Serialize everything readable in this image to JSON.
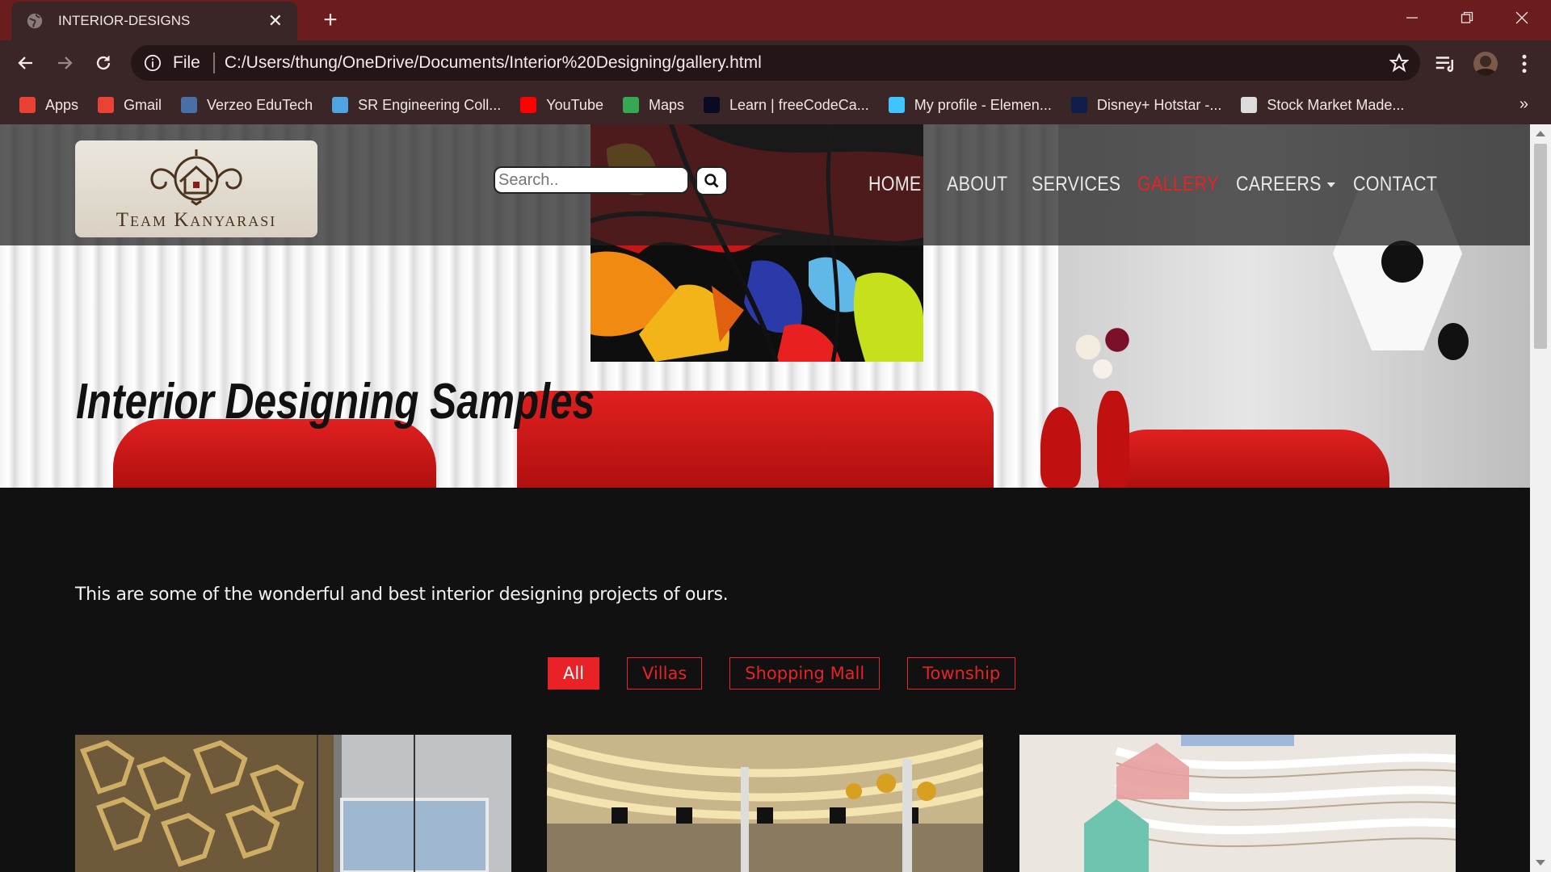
{
  "browser": {
    "tab_title": "INTERIOR-DESIGNS",
    "new_tab": "+",
    "address_scheme": "File",
    "address_url": "C:/Users/thung/OneDrive/Documents/Interior%20Designing/gallery.html",
    "bookmarks": [
      {
        "label": "Apps",
        "icon": "apps-grid-icon",
        "color": "#e94235"
      },
      {
        "label": "Gmail",
        "icon": "gmail-icon",
        "color": "#ea4335"
      },
      {
        "label": "Verzeo EduTech",
        "icon": "verzeo-icon",
        "color": "#4a6fa5"
      },
      {
        "label": "SR Engineering Coll...",
        "icon": "sr-engineering-icon",
        "color": "#4fa3e0"
      },
      {
        "label": "YouTube",
        "icon": "youtube-icon",
        "color": "#ff0000"
      },
      {
        "label": "Maps",
        "icon": "maps-icon",
        "color": "#34a853"
      },
      {
        "label": "Learn | freeCodeCa...",
        "icon": "freecodecamp-icon",
        "color": "#0a0a23"
      },
      {
        "label": "My profile - Elemen...",
        "icon": "element-icon",
        "color": "#40c4ff"
      },
      {
        "label": "Disney+ Hotstar -...",
        "icon": "hotstar-icon",
        "color": "#0f1d4a"
      },
      {
        "label": "Stock Market Made...",
        "icon": "stock-market-icon",
        "color": "#dcdcdc"
      }
    ],
    "more_bookmarks": "»"
  },
  "site": {
    "logo_text": "Team Kanyarasi",
    "search_placeholder": "Search..",
    "nav": [
      {
        "label": "HOME",
        "active": false
      },
      {
        "label": "ABOUT",
        "active": false
      },
      {
        "label": "SERVICES",
        "active": false
      },
      {
        "label": "GALLERY",
        "active": true
      },
      {
        "label": "CAREERS",
        "active": false,
        "dropdown": true
      },
      {
        "label": "CONTACT",
        "active": false
      }
    ],
    "hero_title": "Interior Designing Samples",
    "intro": "This are some of the wonderful and best interior designing projects of ours.",
    "filters": [
      {
        "label": "All",
        "active": true
      },
      {
        "label": "Villas",
        "active": false
      },
      {
        "label": "Shopping Mall",
        "active": false
      },
      {
        "label": "Township",
        "active": false
      }
    ],
    "gallery_items": [
      "gallery-image-villa-interior",
      "gallery-image-food-court-mall",
      "gallery-image-atrium-mall"
    ]
  },
  "colors": {
    "accent_red": "#e82226",
    "tab_bar": "#6b1c1c",
    "toolbar": "#3a2626",
    "page_bg": "#111111"
  }
}
